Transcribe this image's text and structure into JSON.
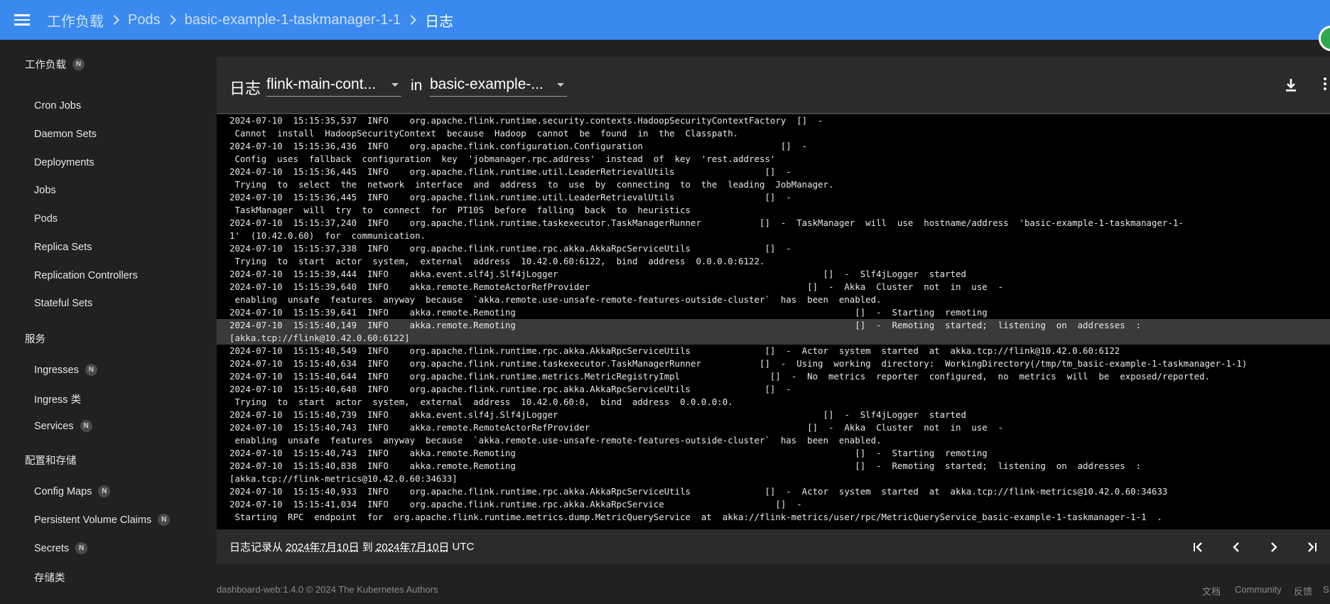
{
  "colors": {
    "topbar": "#3a89ee",
    "background": "#212121",
    "panel": "#2b2b2b",
    "log_bg": "#000000",
    "accent_avatar": "#2fa84f"
  },
  "header": {
    "breadcrumbs": [
      "工作负载",
      "Pods",
      "basic-example-1-taskmanager-1-1",
      "日志"
    ]
  },
  "sidebar": {
    "sections": [
      {
        "label": "工作负载",
        "badge": "N",
        "items": [
          {
            "label": "Cron Jobs"
          },
          {
            "label": "Daemon Sets"
          },
          {
            "label": "Deployments"
          },
          {
            "label": "Jobs"
          },
          {
            "label": "Pods"
          },
          {
            "label": "Replica Sets"
          },
          {
            "label": "Replication Controllers"
          },
          {
            "label": "Stateful Sets"
          }
        ]
      },
      {
        "label": "服务",
        "items": [
          {
            "label": "Ingresses",
            "badge": "N"
          },
          {
            "label": "Ingress 类"
          },
          {
            "label": "Services",
            "badge": "N"
          }
        ]
      },
      {
        "label": "配置和存储",
        "items": [
          {
            "label": "Config Maps",
            "badge": "N"
          },
          {
            "label": "Persistent Volume Claims",
            "badge": "N"
          },
          {
            "label": "Secrets",
            "badge": "N"
          },
          {
            "label": "存储类"
          }
        ]
      }
    ]
  },
  "panel": {
    "title": "日志",
    "container_select": "flink-main-cont...",
    "in_label": "in",
    "pod_select": "basic-example-...",
    "icons": [
      "download-icon",
      "more-vert-icon"
    ]
  },
  "logs": [
    "2024-07-10  15:15:35,537  INFO    org.apache.flink.runtime.security.contexts.HadoopSecurityContextFactory  []  -",
    " Cannot  install  HadoopSecurityContext  because  Hadoop  cannot  be  found  in  the  Classpath.",
    "2024-07-10  15:15:36,436  INFO    org.apache.flink.configuration.Configuration                          []  -",
    " Config  uses  fallback  configuration  key  'jobmanager.rpc.address'  instead  of  key  'rest.address'",
    "2024-07-10  15:15:36,445  INFO    org.apache.flink.runtime.util.LeaderRetrievalUtils                 []  -",
    " Trying  to  select  the  network  interface  and  address  to  use  by  connecting  to  the  leading  JobManager.",
    "2024-07-10  15:15:36,445  INFO    org.apache.flink.runtime.util.LeaderRetrievalUtils                 []  -",
    " TaskManager  will  try  to  connect  for  PT10S  before  falling  back  to  heuristics",
    "2024-07-10  15:15:37,240  INFO    org.apache.flink.runtime.taskexecutor.TaskManagerRunner           []  -  TaskManager  will  use  hostname/address  'basic-example-1-taskmanager-1-",
    "1'  (10.42.0.60)  for  communication.",
    "2024-07-10  15:15:37,338  INFO    org.apache.flink.runtime.rpc.akka.AkkaRpcServiceUtils              []  -",
    " Trying  to  start  actor  system,  external  address  10.42.0.60:6122,  bind  address  0.0.0.0:6122.",
    "2024-07-10  15:15:39,444  INFO    akka.event.slf4j.Slf4jLogger                                                  []  -  Slf4jLogger  started",
    "2024-07-10  15:15:39,640  INFO    akka.remote.RemoteActorRefProvider                                         []  -  Akka  Cluster  not  in  use  -",
    " enabling  unsafe  features  anyway  because  `akka.remote.use-unsafe-remote-features-outside-cluster`  has  been  enabled.",
    "2024-07-10  15:15:39,641  INFO    akka.remote.Remoting                                                                []  -  Starting  remoting",
    "2024-07-10  15:15:40,149  INFO    akka.remote.Remoting                                                                []  -  Remoting  started;  listening  on  addresses  :",
    "[akka.tcp://flink@10.42.0.60:6122]",
    "2024-07-10  15:15:40,549  INFO    org.apache.flink.runtime.rpc.akka.AkkaRpcServiceUtils              []  -  Actor  system  started  at  akka.tcp://flink@10.42.0.60:6122",
    "2024-07-10  15:15:40,634  INFO    org.apache.flink.runtime.taskexecutor.TaskManagerRunner           []  -  Using  working  directory:  WorkingDirectory(/tmp/tm_basic-example-1-taskmanager-1-1)",
    "2024-07-10  15:15:40,644  INFO    org.apache.flink.runtime.metrics.MetricRegistryImpl                 []  -  No  metrics  reporter  configured,  no  metrics  will  be  exposed/reported.",
    "2024-07-10  15:15:40,648  INFO    org.apache.flink.runtime.rpc.akka.AkkaRpcServiceUtils              []  -",
    " Trying  to  start  actor  system,  external  address  10.42.0.60:0,  bind  address  0.0.0.0:0.",
    "2024-07-10  15:15:40,739  INFO    akka.event.slf4j.Slf4jLogger                                                  []  -  Slf4jLogger  started",
    "2024-07-10  15:15:40,743  INFO    akka.remote.RemoteActorRefProvider                                         []  -  Akka  Cluster  not  in  use  -",
    " enabling  unsafe  features  anyway  because  `akka.remote.use-unsafe-remote-features-outside-cluster`  has  been  enabled.",
    "2024-07-10  15:15:40,743  INFO    akka.remote.Remoting                                                                []  -  Starting  remoting",
    "2024-07-10  15:15:40,838  INFO    akka.remote.Remoting                                                                []  -  Remoting  started;  listening  on  addresses  :",
    "[akka.tcp://flink-metrics@10.42.0.60:34633]",
    "2024-07-10  15:15:40,933  INFO    org.apache.flink.runtime.rpc.akka.AkkaRpcServiceUtils              []  -  Actor  system  started  at  akka.tcp://flink-metrics@10.42.0.60:34633",
    "2024-07-10  15:15:41,034  INFO    org.apache.flink.runtime.rpc.akka.AkkaRpcService                     []  -",
    " Starting  RPC  endpoint  for  org.apache.flink.runtime.metrics.dump.MetricQueryService  at  akka://flink-metrics/user/rpc/MetricQueryService_basic-example-1-taskmanager-1-1  ."
  ],
  "highlighted_lines": [
    16,
    17
  ],
  "footer_bar": {
    "prefix": "日志记录从",
    "from_date": "2024年7月10日",
    "to_label": "到",
    "to_date": "2024年7月10日",
    "tz": "UTC"
  },
  "footer": {
    "version": "dashboard-web:1.4.0 © 2024 The Kubernetes Authors",
    "links": [
      "文档",
      "Community",
      "反馈",
      "S"
    ]
  }
}
